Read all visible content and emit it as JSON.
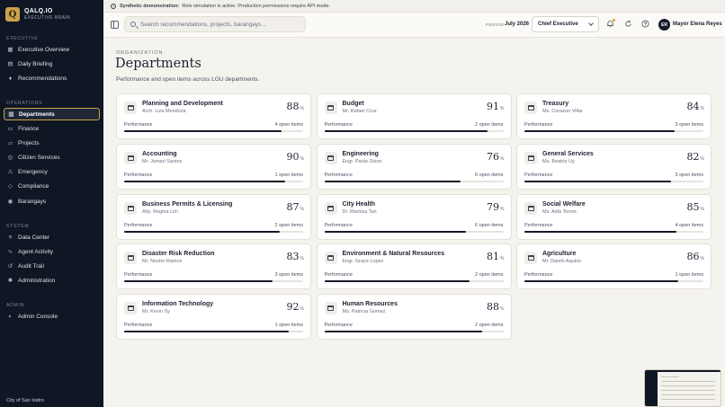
{
  "brand": {
    "name": "QALQ.IO",
    "subtitle": "EXECUTIVE BRAIN",
    "logo_letter": "Q"
  },
  "banner": {
    "label": "Synthetic demonstration:",
    "text": "Role simulation is active. Production permissions require API mode."
  },
  "sidebar": {
    "sections": [
      {
        "heading": "EXECUTIVE",
        "items": [
          {
            "label": "Executive Overview",
            "icon": "grid-icon"
          },
          {
            "label": "Daily Briefing",
            "icon": "calendar-icon"
          },
          {
            "label": "Recommendations",
            "icon": "lightbulb-icon"
          }
        ]
      },
      {
        "heading": "OPERATIONS",
        "items": [
          {
            "label": "Departments",
            "icon": "building-icon",
            "active": true
          },
          {
            "label": "Finance",
            "icon": "wallet-icon"
          },
          {
            "label": "Projects",
            "icon": "folder-icon"
          },
          {
            "label": "Citizen Services",
            "icon": "users-icon"
          },
          {
            "label": "Emergency",
            "icon": "alert-icon"
          },
          {
            "label": "Compliance",
            "icon": "shield-icon"
          },
          {
            "label": "Barangays",
            "icon": "map-pin-icon"
          }
        ]
      },
      {
        "heading": "SYSTEM",
        "items": [
          {
            "label": "Data Center",
            "icon": "database-icon"
          },
          {
            "label": "Agent Activity",
            "icon": "activity-icon"
          },
          {
            "label": "Audit Trail",
            "icon": "history-icon"
          },
          {
            "label": "Administration",
            "icon": "gear-icon"
          }
        ]
      },
      {
        "heading": "ADMIN",
        "items": [
          {
            "label": "Admin Console",
            "icon": "console-icon"
          }
        ]
      }
    ],
    "footer": "City of San Isidro"
  },
  "header": {
    "search_placeholder": "Search recommendations, projects, barangays...",
    "period_label": "PERIOD",
    "period_value": "July 2026",
    "role": "Chief Executive",
    "user_initials": "ER",
    "user_name": "Mayor Elena Reyes"
  },
  "page": {
    "eyebrow": "ORGANIZATION",
    "title": "Departments",
    "subtitle": "Performance and open items across LGU departments.",
    "perf_label": "Performance"
  },
  "departments": [
    {
      "name": "Planning and Development",
      "head": "Arch. Liza Mendoza",
      "score": 88,
      "open_items": "4 open items"
    },
    {
      "name": "Budget",
      "head": "Mr. Rafael Cruz",
      "score": 91,
      "open_items": "2 open items"
    },
    {
      "name": "Treasury",
      "head": "Ms. Corazon Villar",
      "score": 84,
      "open_items": "3 open items"
    },
    {
      "name": "Accounting",
      "head": "Mr. Jomari Santos",
      "score": 90,
      "open_items": "1 open items"
    },
    {
      "name": "Engineering",
      "head": "Engr. Paolo Dizon",
      "score": 76,
      "open_items": "6 open items"
    },
    {
      "name": "General Services",
      "head": "Ms. Beatriz Uy",
      "score": 82,
      "open_items": "3 open items"
    },
    {
      "name": "Business Permits & Licensing",
      "head": "Atty. Regina Lim",
      "score": 87,
      "open_items": "2 open items"
    },
    {
      "name": "City Health",
      "head": "Dr. Marissa Tan",
      "score": 79,
      "open_items": "6 open items"
    },
    {
      "name": "Social Welfare",
      "head": "Ms. Aida Torres",
      "score": 85,
      "open_items": "4 open items"
    },
    {
      "name": "Disaster Risk Reduction",
      "head": "Mr. Nestor Ramos",
      "score": 83,
      "open_items": "3 open items"
    },
    {
      "name": "Environment & Natural Resources",
      "head": "Engr. Grace Lopez",
      "score": 81,
      "open_items": "2 open items"
    },
    {
      "name": "Agriculture",
      "head": "Mr. Danilo Aquino",
      "score": 86,
      "open_items": "1 open items"
    },
    {
      "name": "Information Technology",
      "head": "Mr. Kevin Sy",
      "score": 92,
      "open_items": "1 open items"
    },
    {
      "name": "Human Resources",
      "head": "Ms. Patricia Gomez",
      "score": 88,
      "open_items": "2 open items"
    }
  ],
  "colors": {
    "accent": "#c9a24a",
    "sidebar": "#0f1624",
    "bar": "#141a27"
  }
}
